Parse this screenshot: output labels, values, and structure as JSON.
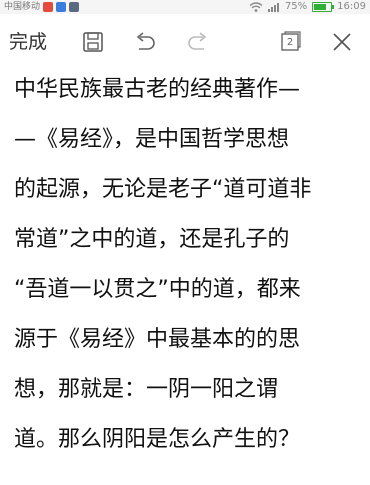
{
  "status_bar": {
    "carrier": "中国移动",
    "battery_percent": "75%",
    "battery_level": 0.75,
    "time": "16:09"
  },
  "toolbar": {
    "done_label": "完成",
    "page_count": "2",
    "icons": [
      "save-icon",
      "undo-icon",
      "redo-icon",
      "page-count-icon",
      "close-icon"
    ]
  },
  "content": {
    "lines": [
      "中华民族最古老的经典著作—",
      "—《易经》，是中国哲学思想",
      "的起源，无论是老子“道可道非",
      "常道”之中的道，还是孔子的",
      "“吾道一以贯之”中的道，都来",
      "源于《易经》中最基本的的思",
      "想，那就是：一阴一阳之谓",
      "道。那么阴阳是怎么产生的？"
    ]
  }
}
